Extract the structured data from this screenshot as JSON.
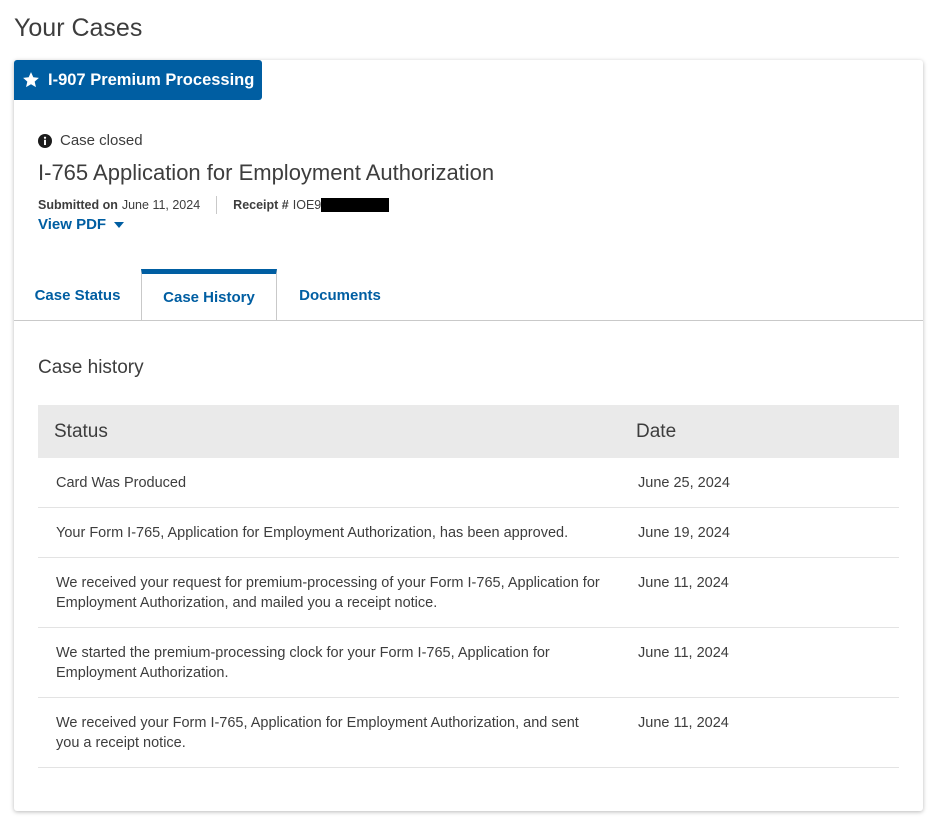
{
  "page": {
    "title": "Your Cases"
  },
  "case": {
    "badge_label": "I-907 Premium Processing",
    "status_text": "Case closed",
    "title": "I-765 Application for Employment Authorization",
    "submitted_label": "Submitted on",
    "submitted_date": "June 11, 2024",
    "receipt_label": "Receipt #",
    "receipt_value": "IOE9",
    "view_pdf_label": "View PDF"
  },
  "tabs": [
    {
      "label": "Case Status",
      "active": false
    },
    {
      "label": "Case History",
      "active": true
    },
    {
      "label": "Documents",
      "active": false
    }
  ],
  "history": {
    "title": "Case history",
    "columns": [
      "Status",
      "Date"
    ],
    "rows": [
      {
        "status": "Card Was Produced",
        "date": "June 25, 2024"
      },
      {
        "status": "Your Form I-765, Application for Employment Authorization, has been approved.",
        "date": "June 19, 2024"
      },
      {
        "status": "We received your request for premium-processing of your Form I-765, Application for Employment Authorization, and mailed you a receipt notice.",
        "date": "June 11, 2024"
      },
      {
        "status": "We started the premium-processing clock for your Form I-765, Application for Employment Authorization.",
        "date": "June 11, 2024"
      },
      {
        "status": "We received your Form I-765, Application for Employment Authorization, and sent you a receipt notice.",
        "date": "June 11, 2024"
      }
    ]
  },
  "colors": {
    "accent": "#005ea2",
    "header_bg": "#eaeaea",
    "text": "#3d3d3d"
  },
  "icons": {
    "badge": "star-icon",
    "status": "info-circle-icon",
    "pdf": "caret-down-icon"
  }
}
